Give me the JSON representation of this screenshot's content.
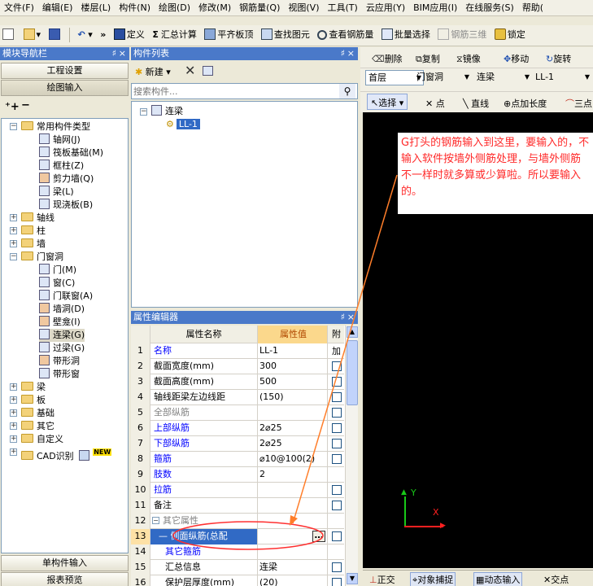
{
  "menu": [
    "文件(F)",
    "编辑(E)",
    "楼层(L)",
    "构件(N)",
    "绘图(D)",
    "修改(M)",
    "钢筋量(Q)",
    "视图(V)",
    "工具(T)",
    "云应用(Y)",
    "BIM应用(I)",
    "在线服务(S)",
    "帮助("
  ],
  "toolbar": {
    "define": "定义",
    "sum": "汇总计算",
    "flat": "平齐板顶",
    "find": "查找图元",
    "view_rebar": "查看钢筋量",
    "batch": "批量选择",
    "rebar3d": "钢筋三维",
    "lock": "锁定",
    "more": "»"
  },
  "nav": {
    "title": "模块导航栏",
    "pin": "♯",
    "close": "×",
    "btn_project": "工程设置",
    "btn_draw": "绘图输入",
    "btn_single": "单构件输入",
    "btn_report": "报表预览"
  },
  "tree": {
    "common": "常用构件类型",
    "common_items": [
      "轴网(J)",
      "筏板基础(M)",
      "框柱(Z)",
      "剪力墙(Q)",
      "梁(L)",
      "现浇板(B)"
    ],
    "axis": "轴线",
    "column": "柱",
    "wall": "墙",
    "door_window": "门窗洞",
    "dw_items": [
      "门(M)",
      "窗(C)",
      "门联窗(A)",
      "墙洞(D)",
      "壁龛(I)",
      "连梁(G)",
      "过梁(G)",
      "带形洞",
      "带形窗"
    ],
    "beam": "梁",
    "slab": "板",
    "foundation": "基础",
    "other": "其它",
    "custom": "自定义",
    "cad": "CAD识别",
    "new_badge": "NEW"
  },
  "complist": {
    "title": "构件列表",
    "new": "新建",
    "search_placeholder": "搜索构件...",
    "root": "连梁",
    "item": "LL-1"
  },
  "props": {
    "title": "属性编辑器",
    "headers": [
      "属性名称",
      "属性值",
      "附加"
    ],
    "rows": [
      {
        "n": "1",
        "name": "名称",
        "val": "LL-1",
        "cls": "blue",
        "chk": false
      },
      {
        "n": "2",
        "name": "截面宽度(mm)",
        "val": "300",
        "cls": "",
        "chk": true
      },
      {
        "n": "3",
        "name": "截面高度(mm)",
        "val": "500",
        "cls": "",
        "chk": true
      },
      {
        "n": "4",
        "name": "轴线距梁左边线距",
        "val": "(150)",
        "cls": "",
        "chk": true
      },
      {
        "n": "5",
        "name": "全部纵筋",
        "val": "",
        "cls": "gray",
        "chk": true
      },
      {
        "n": "6",
        "name": "上部纵筋",
        "val": "2⌀25",
        "cls": "blue",
        "chk": true
      },
      {
        "n": "7",
        "name": "下部纵筋",
        "val": "2⌀25",
        "cls": "blue",
        "chk": true
      },
      {
        "n": "8",
        "name": "箍筋",
        "val": "⌀10@100(2)",
        "cls": "blue",
        "chk": true
      },
      {
        "n": "9",
        "name": "肢数",
        "val": "2",
        "cls": "blue",
        "chk": false
      },
      {
        "n": "10",
        "name": "拉筋",
        "val": "",
        "cls": "blue",
        "chk": true
      },
      {
        "n": "11",
        "name": "备注",
        "val": "",
        "cls": "",
        "chk": true
      },
      {
        "n": "12",
        "name": "其它属性",
        "val": "",
        "cls": "gray",
        "chk": false
      },
      {
        "n": "13",
        "name": "侧面纵筋(总配",
        "val": "",
        "cls": "sel",
        "chk": true
      },
      {
        "n": "14",
        "name": "其它箍筋",
        "val": "",
        "cls": "blue",
        "chk": false
      },
      {
        "n": "15",
        "name": "汇总信息",
        "val": "连梁",
        "cls": "",
        "chk": true
      },
      {
        "n": "16",
        "name": "保护层厚度(mm)",
        "val": "(20)",
        "cls": "",
        "chk": true
      }
    ],
    "ellipsis": "…"
  },
  "edit": {
    "delete": "删除",
    "copy": "复制",
    "mirror": "镜像",
    "move": "移动",
    "rotate": "旋转",
    "floor": "首层",
    "category": "门窗洞",
    "type": "连梁",
    "member": "LL-1",
    "select": "选择",
    "point": "点",
    "line": "直线",
    "point_len": "点加长度",
    "arc": "三点"
  },
  "annotation": "G打头的钢筋输入到这里，要输入的，不输入软件按墙外侧筋处理，与墙外侧筋不一样时就多算或少算啦。所以要输入的。",
  "axes": {
    "x": "X",
    "y": "Y"
  },
  "status": {
    "ortho": "正交",
    "snap": "对象捕捉",
    "dynamic": "动态输入",
    "intersect": "交点"
  },
  "colors": {
    "title_bar": "#4a79c9",
    "annotation": "#ff2a2a",
    "arrow": "#ff7e2a",
    "axis_x": "#ff2020",
    "axis_y": "#18c818"
  }
}
